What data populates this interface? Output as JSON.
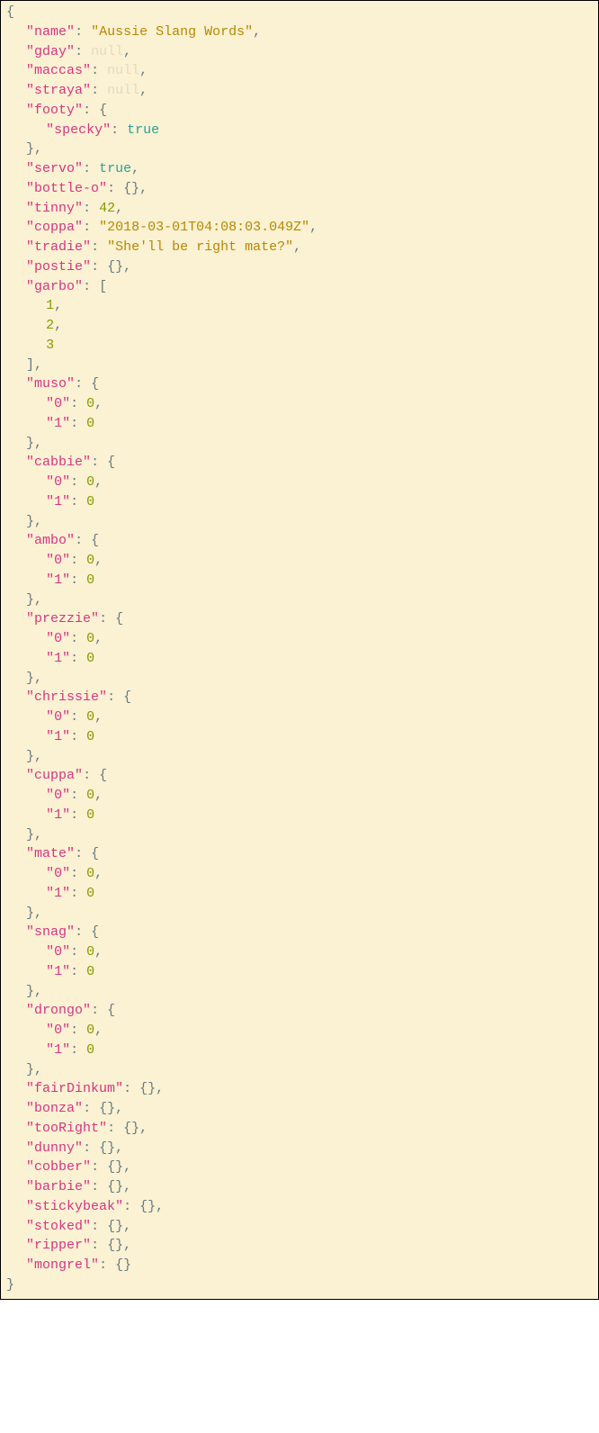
{
  "json": {
    "name_key": "name",
    "name_val": "Aussie Slang Words",
    "null_keys": [
      "gday",
      "maccas",
      "straya"
    ],
    "footy_key": "footy",
    "specky_key": "specky",
    "specky_val": "true",
    "servo_key": "servo",
    "servo_val": "true",
    "bottleo_key": "bottle-o",
    "tinny_key": "tinny",
    "tinny_val": "42",
    "coppa_key": "coppa",
    "coppa_val": "2018-03-01T04:08:03.049Z",
    "tradie_key": "tradie",
    "tradie_val": "She'll be right mate?",
    "postie_key": "postie",
    "garbo_key": "garbo",
    "garbo_vals": [
      "1",
      "2",
      "3"
    ],
    "obj01_keys": [
      "muso",
      "cabbie",
      "ambo",
      "prezzie",
      "chrissie",
      "cuppa",
      "mate",
      "snag",
      "drongo"
    ],
    "sub0_key": "0",
    "sub0_val": "0",
    "sub1_key": "1",
    "sub1_val": "0",
    "empty_obj_keys": [
      "fairDinkum",
      "bonza",
      "tooRight",
      "dunny",
      "cobber",
      "barbie",
      "stickybeak",
      "stoked",
      "ripper",
      "mongrel"
    ],
    "null_literal": "null"
  }
}
